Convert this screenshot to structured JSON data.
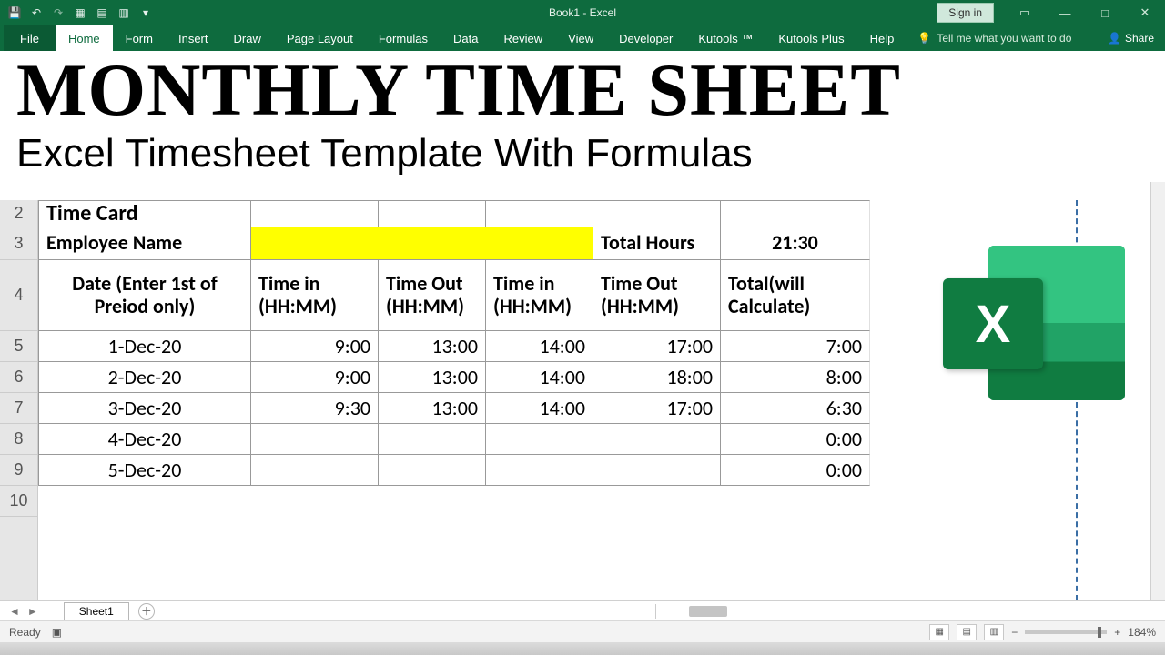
{
  "titlebar": {
    "doc_title": "Book1 - Excel",
    "signin": "Sign in"
  },
  "ribbon": {
    "tabs": [
      "File",
      "Home",
      "Form",
      "Insert",
      "Draw",
      "Page Layout",
      "Formulas",
      "Data",
      "Review",
      "View",
      "Developer",
      "Kutools ™",
      "Kutools Plus",
      "Help"
    ],
    "active": "Home",
    "tell_me": "Tell me what you want to do",
    "share": "Share"
  },
  "overlay": {
    "line1": "MONTHLY TIME SHEET",
    "line2": "Excel Timesheet Template With Formulas"
  },
  "sheet": {
    "row2_label": "Time Card",
    "row3": {
      "label": "Employee Name",
      "total_hours_label": "Total Hours",
      "total_hours_value": "21:30"
    },
    "headers": {
      "date": "Date (Enter 1st of Preiod only)",
      "time_in1": "Time in (HH:MM)",
      "time_out1": "Time Out (HH:MM)",
      "time_in2": "Time in (HH:MM)",
      "time_out2": "Time Out (HH:MM)",
      "total": "Total(will Calculate)"
    },
    "rows": [
      {
        "rownum": "5",
        "date": "1-Dec-20",
        "in1": "9:00",
        "out1": "13:00",
        "in2": "14:00",
        "out2": "17:00",
        "total": "7:00"
      },
      {
        "rownum": "6",
        "date": "2-Dec-20",
        "in1": "9:00",
        "out1": "13:00",
        "in2": "14:00",
        "out2": "18:00",
        "total": "8:00"
      },
      {
        "rownum": "7",
        "date": "3-Dec-20",
        "in1": "9:30",
        "out1": "13:00",
        "in2": "14:00",
        "out2": "17:00",
        "total": "6:30"
      },
      {
        "rownum": "8",
        "date": "4-Dec-20",
        "in1": "",
        "out1": "",
        "in2": "",
        "out2": "",
        "total": "0:00"
      },
      {
        "rownum": "9",
        "date": "5-Dec-20",
        "in1": "",
        "out1": "",
        "in2": "",
        "out2": "",
        "total": "0:00"
      }
    ],
    "tab_name": "Sheet1"
  },
  "statusbar": {
    "ready": "Ready",
    "zoom": "184%",
    "minus": "−",
    "plus": "+"
  }
}
